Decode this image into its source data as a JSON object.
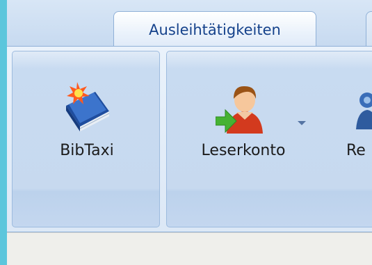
{
  "ribbon": {
    "active_tab": "Ausleihtätigkeiten",
    "groups": [
      {
        "buttons": [
          {
            "label": "BibTaxi",
            "icon": "book-with-burst-icon"
          }
        ]
      },
      {
        "buttons": [
          {
            "label": "Leserkonto",
            "icon": "user-arrow-icon",
            "has_dropdown": true
          },
          {
            "label": "Re",
            "icon": "user-group-icon"
          }
        ]
      }
    ]
  }
}
